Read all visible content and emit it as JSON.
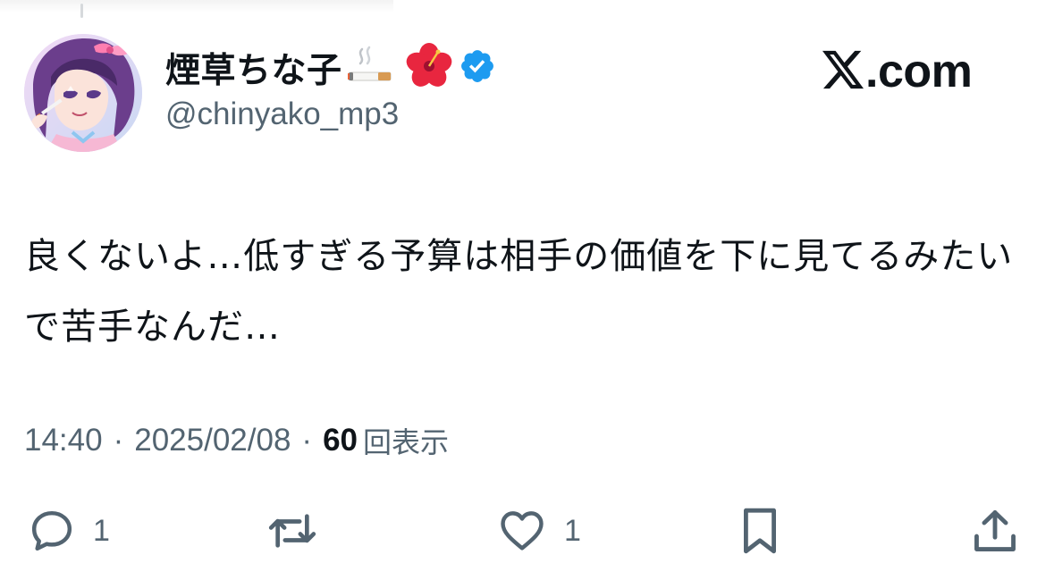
{
  "author": {
    "display_name": "煙草ちな子",
    "name_emojis": [
      "cigarette-icon",
      "hibiscus-icon",
      "verified-badge-icon"
    ],
    "handle": "@chinyako_mp3"
  },
  "brand": {
    "text": ".com",
    "logo": "x-logo-icon"
  },
  "tweet": {
    "text": "良くないよ…低すぎる予算は相手の価値を下に見てるみたいで苦手なんだ…"
  },
  "meta": {
    "time": "14:40",
    "separator": "·",
    "date": "2025/02/08",
    "views_count": "60",
    "views_label": "回表示"
  },
  "actions": {
    "reply_count": "1",
    "retweet_count": "",
    "like_count": "1"
  },
  "colors": {
    "text_primary": "#0f1419",
    "text_secondary": "#536471",
    "verified": "#1d9bf0"
  }
}
